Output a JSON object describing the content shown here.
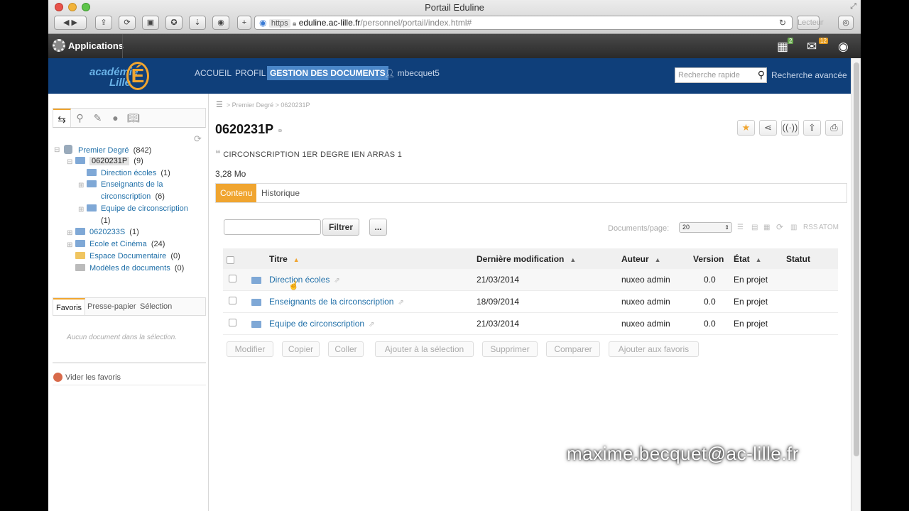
{
  "window": {
    "title": "Portail Eduline"
  },
  "toolbar": {
    "url_scheme": "https",
    "url_host": "eduline.ac-lille.fr",
    "url_path": "/personnel/portail/index.html#",
    "reader": "Lecteur"
  },
  "appsbar": {
    "label": "Applications",
    "badge_apps": "2",
    "badge_mail": "12"
  },
  "header": {
    "logo_line1": "académie",
    "logo_line2": "Lille",
    "logo_letter": "É",
    "nav": [
      "ACCUEIL",
      "PROFIL",
      "GESTION DES DOCUMENTS"
    ],
    "user": "mbecquet5",
    "search_placeholder": "Recherche rapide",
    "advanced_search": "Recherche avancée"
  },
  "sidebar": {
    "tree": [
      {
        "label": "Premier Degré",
        "count": "(842)"
      },
      {
        "label": "0620231P",
        "count": "(9)"
      },
      {
        "label": "Direction écoles",
        "count": "(1)"
      },
      {
        "label": "Enseignants de la",
        "label2": "circonscription",
        "count": "(6)"
      },
      {
        "label": "Equipe de circonscription",
        "count": "(1)"
      },
      {
        "label": "0620233S",
        "count": "(1)"
      },
      {
        "label": "Ecole et Cinéma",
        "count": "(24)"
      },
      {
        "label": "Espace Documentaire",
        "count": "(0)"
      },
      {
        "label": "Modèles de documents",
        "count": "(0)"
      }
    ],
    "bottom_tabs": [
      "Favoris",
      "Presse-papier",
      "Sélection"
    ],
    "empty_message": "Aucun document dans la sélection.",
    "clear_favorites": "Vider les favoris"
  },
  "main": {
    "breadcrumb": "> Premier Degré > 0620231P",
    "title": "0620231P",
    "description": "CIRCONSCRIPTION 1ER DEGRE IEN ARRAS 1",
    "size": "3,28 Mo",
    "tabs": [
      "Contenu",
      "Historique"
    ],
    "filter_button": "Filtrer",
    "more_button": "...",
    "docs_per_page_label": "Documents/page:",
    "docs_per_page_value": "20",
    "rss": "RSS",
    "atom": "ATOM",
    "columns": [
      "Titre",
      "Dernière modification",
      "Auteur",
      "Version",
      "État",
      "Statut"
    ],
    "rows": [
      {
        "title": "Direction écoles",
        "modified": "21/03/2014",
        "author": "nuxeo admin",
        "version": "0.0",
        "state": "En projet",
        "status": ""
      },
      {
        "title": "Enseignants de la circonscription",
        "modified": "18/09/2014",
        "author": "nuxeo admin",
        "version": "0.0",
        "state": "En projet",
        "status": ""
      },
      {
        "title": "Equipe de circonscription",
        "modified": "21/03/2014",
        "author": "nuxeo admin",
        "version": "0.0",
        "state": "En projet",
        "status": ""
      }
    ],
    "actions": [
      "Modifier",
      "Copier",
      "Coller",
      "Ajouter à la sélection",
      "Supprimer",
      "Comparer",
      "Ajouter aux favoris"
    ]
  },
  "watermark": "maxime.becquet@ac-lille.fr",
  "colors": {
    "header": "#0f3f7a",
    "accent": "#f0a530",
    "link": "#1f6fa8"
  }
}
